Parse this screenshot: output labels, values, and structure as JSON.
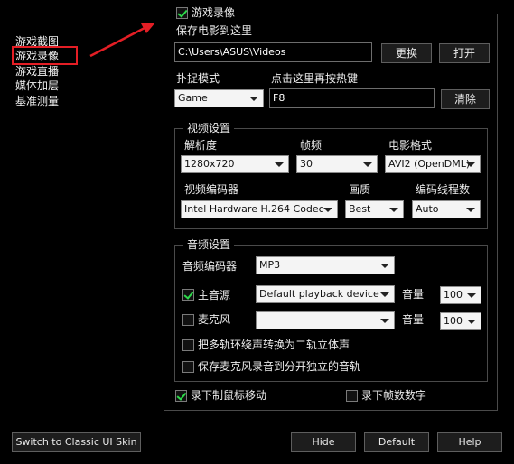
{
  "sidebar": {
    "items": [
      {
        "label": "游戏截图"
      },
      {
        "label": "游戏录像"
      },
      {
        "label": "游戏直播"
      },
      {
        "label": "媒体加层"
      },
      {
        "label": "基准测量"
      }
    ]
  },
  "header": {
    "enable_label": "游戏录像",
    "enable_checked": true
  },
  "save": {
    "label": "保存电影到这里",
    "path": "C:\\Users\\ASUS\\Videos",
    "change_button": "更换",
    "open_button": "打开"
  },
  "capture": {
    "mode_label": "扑捉模式",
    "mode_value": "Game",
    "hotkey_label": "点击这里再按热键",
    "hotkey_value": "F8",
    "clear_button": "清除"
  },
  "video": {
    "title": "视频设置",
    "resolution_label": "解析度",
    "resolution_value": "1280x720",
    "fps_label": "帧频",
    "fps_value": "30",
    "format_label": "电影格式",
    "format_value": "AVI2 (OpenDML)",
    "codec_label": "视频编码器",
    "codec_value": "Intel Hardware H.264 Codec",
    "quality_label": "画质",
    "quality_value": "Best",
    "threads_label": "编码线程数",
    "threads_value": "Auto"
  },
  "audio": {
    "title": "音频设置",
    "codec_label": "音频编码器",
    "codec_value": "MP3",
    "main_label": "主音源",
    "main_checked": true,
    "main_device": "Default playback device",
    "main_volume_label": "音量",
    "main_volume": "100",
    "mic_label": "麦克风",
    "mic_checked": false,
    "mic_device": "",
    "mic_volume_label": "音量",
    "mic_volume": "100",
    "stereo_label": "把多轨环绕声转换为二轨立体声",
    "separate_label": "保存麦克风录音到分开独立的音轨"
  },
  "bottom": {
    "record_cursor_label": "录下制鼠标移动",
    "record_cursor_checked": true,
    "record_fps_label": "录下帧数数字",
    "record_fps_checked": false
  },
  "footer": {
    "classic_skin": "Switch to Classic UI Skin",
    "hide": "Hide",
    "default": "Default",
    "help": "Help"
  },
  "colors": {
    "accent_check": "#2cd94a",
    "highlight_red": "#e41e25"
  }
}
